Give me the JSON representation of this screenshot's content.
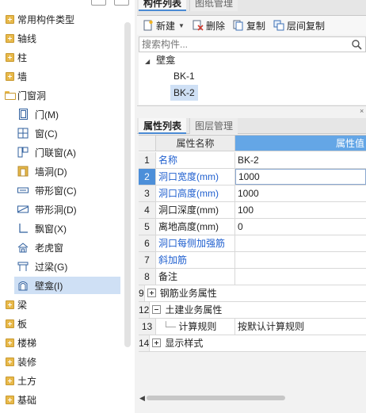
{
  "left_tree": {
    "items": [
      {
        "type": "cat",
        "label": "常用构件类型",
        "expanded": false
      },
      {
        "type": "cat",
        "label": "轴线",
        "expanded": false
      },
      {
        "type": "cat",
        "label": "柱",
        "expanded": false
      },
      {
        "type": "cat",
        "label": "墙",
        "expanded": false
      },
      {
        "type": "catopen",
        "label": "门窗洞",
        "expanded": true
      },
      {
        "type": "child",
        "label": "门(M)",
        "icon": "door-icon"
      },
      {
        "type": "child",
        "label": "窗(C)",
        "icon": "window-icon"
      },
      {
        "type": "child",
        "label": "门联窗(A)",
        "icon": "door-window-icon"
      },
      {
        "type": "child",
        "label": "墙洞(D)",
        "icon": "wall-opening-icon"
      },
      {
        "type": "child",
        "label": "带形窗(C)",
        "icon": "strip-window-icon"
      },
      {
        "type": "child",
        "label": "带形洞(D)",
        "icon": "strip-opening-icon"
      },
      {
        "type": "child",
        "label": "飘窗(X)",
        "icon": "bay-window-icon"
      },
      {
        "type": "child",
        "label": "老虎窗",
        "icon": "dormer-icon"
      },
      {
        "type": "child",
        "label": "过梁(G)",
        "icon": "lintel-icon"
      },
      {
        "type": "child",
        "label": "壁龛(I)",
        "icon": "niche-icon",
        "selected": true
      },
      {
        "type": "cat",
        "label": "梁",
        "expanded": false
      },
      {
        "type": "cat",
        "label": "板",
        "expanded": false
      },
      {
        "type": "cat",
        "label": "楼梯",
        "expanded": false
      },
      {
        "type": "cat",
        "label": "装修",
        "expanded": false
      },
      {
        "type": "cat",
        "label": "土方",
        "expanded": false
      },
      {
        "type": "cat",
        "label": "基础",
        "expanded": false
      }
    ]
  },
  "top_tabs": {
    "active": "构件列表",
    "inactive": "图纸管理"
  },
  "toolbar": {
    "new_label": "新建",
    "delete_label": "删除",
    "copy_label": "复制",
    "floor_copy_label": "层间复制"
  },
  "search": {
    "placeholder": "搜索构件..."
  },
  "component_tree": {
    "group": "壁龛",
    "items": [
      "BK-1",
      "BK-2"
    ],
    "selected": "BK-2"
  },
  "bottom_tabs": {
    "active": "属性列表",
    "inactive": "图层管理"
  },
  "prop_grid": {
    "header_name": "属性名称",
    "header_value": "属性值",
    "rows": [
      {
        "num": "1",
        "name": "名称",
        "value": "BK-2",
        "blue": true
      },
      {
        "num": "2",
        "name": "洞口宽度(mm)",
        "value": "1000",
        "blue": true,
        "highlight": true
      },
      {
        "num": "3",
        "name": "洞口高度(mm)",
        "value": "1000",
        "blue": true
      },
      {
        "num": "4",
        "name": "洞口深度(mm)",
        "value": "100",
        "blue": false
      },
      {
        "num": "5",
        "name": "离地高度(mm)",
        "value": "0",
        "blue": false
      },
      {
        "num": "6",
        "name": "洞口每侧加强筋",
        "value": "",
        "blue": true
      },
      {
        "num": "7",
        "name": "斜加筋",
        "value": "",
        "blue": true
      },
      {
        "num": "8",
        "name": "备注",
        "value": "",
        "blue": false
      },
      {
        "num": "9",
        "name": "钢筋业务属性",
        "value": "",
        "group": "plus"
      },
      {
        "num": "12",
        "name": "土建业务属性",
        "value": "",
        "group": "minus"
      },
      {
        "num": "13",
        "name": "计算规则",
        "value": "按默认计算规则",
        "sub": true
      },
      {
        "num": "14",
        "name": "显示样式",
        "value": "",
        "group": "plus"
      }
    ]
  },
  "colors": {
    "accent": "#4c8fd9",
    "selected_bg": "#cfe0f5",
    "folder": "#e9b949",
    "blue_text": "#1f5fcf"
  }
}
